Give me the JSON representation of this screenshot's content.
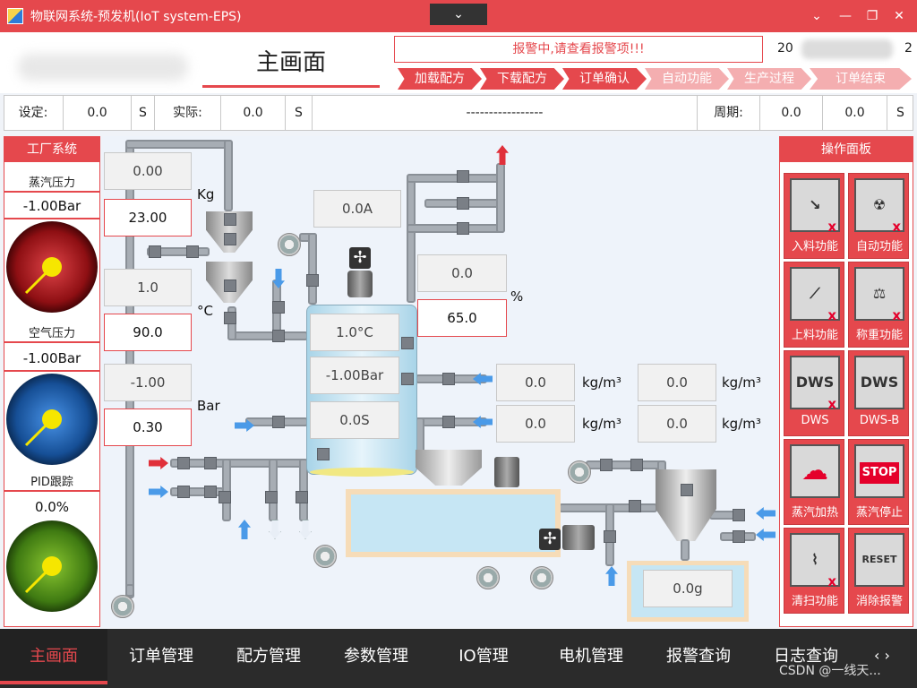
{
  "window": {
    "title": "物联网系统-预发机(IoT system-EPS)",
    "dropdown": "⌄",
    "btn_down": "⌄",
    "btn_min": "—",
    "btn_max": "❐",
    "btn_close": "✕"
  },
  "header": {
    "main_title": "主画面",
    "alarm": "报警中,请查看报警项!!!",
    "date_prefix": "20",
    "date_suffix": "2"
  },
  "steps": [
    "加载配方",
    "下载配方",
    "订单确认",
    "自动功能",
    "生产过程",
    "订单结束"
  ],
  "infobar": {
    "set_label": "设定:",
    "set_value": "0.0",
    "set_unit": "S",
    "actual_label": "实际:",
    "actual_value": "0.0",
    "actual_unit": "S",
    "center": "-----------------",
    "period_label": "周期:",
    "period_value1": "0.0",
    "period_value2": "0.0",
    "period_unit": "S"
  },
  "left_panel": {
    "title": "工厂系统",
    "gauges": [
      {
        "label": "蒸汽压力",
        "value": "-1.00Bar",
        "color": "#b5161b"
      },
      {
        "label": "空气压力",
        "value": "-1.00Bar",
        "color": "#1a5aa8"
      },
      {
        "label": "PID跟踪",
        "value": "0.0%",
        "color": "#4f8a16"
      }
    ]
  },
  "plant": {
    "kg_top": "0.00",
    "kg_set": "23.00",
    "kg_unit": "Kg",
    "temp_top": "1.0",
    "temp_set": "90.0",
    "temp_unit": "°C",
    "bar_top": "-1.00",
    "bar_set": "0.30",
    "bar_unit": "Bar",
    "current": "0.0A",
    "pct_top": "0.0",
    "pct_set": "65.0",
    "pct_unit": "%",
    "tank_temp": "1.0°C",
    "tank_press": "-1.00Bar",
    "tank_time": "0.0S",
    "dens1": "0.0",
    "dens2": "0.0",
    "dens3": "0.0",
    "dens4": "0.0",
    "dens_unit": "kg/m³",
    "scale": "0.0g"
  },
  "right_panel": {
    "title": "操作面板",
    "buttons": [
      {
        "label": "入料功能",
        "icon": "↘"
      },
      {
        "label": "自动功能",
        "icon": "☢"
      },
      {
        "label": "上料功能",
        "icon": "⟋"
      },
      {
        "label": "称重功能",
        "icon": "⚖"
      },
      {
        "label": "DWS",
        "icon": "DWS"
      },
      {
        "label": "DWS-B",
        "icon": "DWS"
      },
      {
        "label": "蒸汽加热",
        "icon": "☁"
      },
      {
        "label": "蒸汽停止",
        "icon": "STOP"
      },
      {
        "label": "清扫功能",
        "icon": "⌇"
      },
      {
        "label": "消除报警",
        "icon": "RESET"
      }
    ],
    "x_mark": "x"
  },
  "nav": [
    "主画面",
    "订单管理",
    "配方管理",
    "参数管理",
    "IO管理",
    "电机管理",
    "报警查询",
    "日志查询"
  ],
  "watermark": "CSDN @一线天...",
  "nav_scroll": "‹ ›"
}
